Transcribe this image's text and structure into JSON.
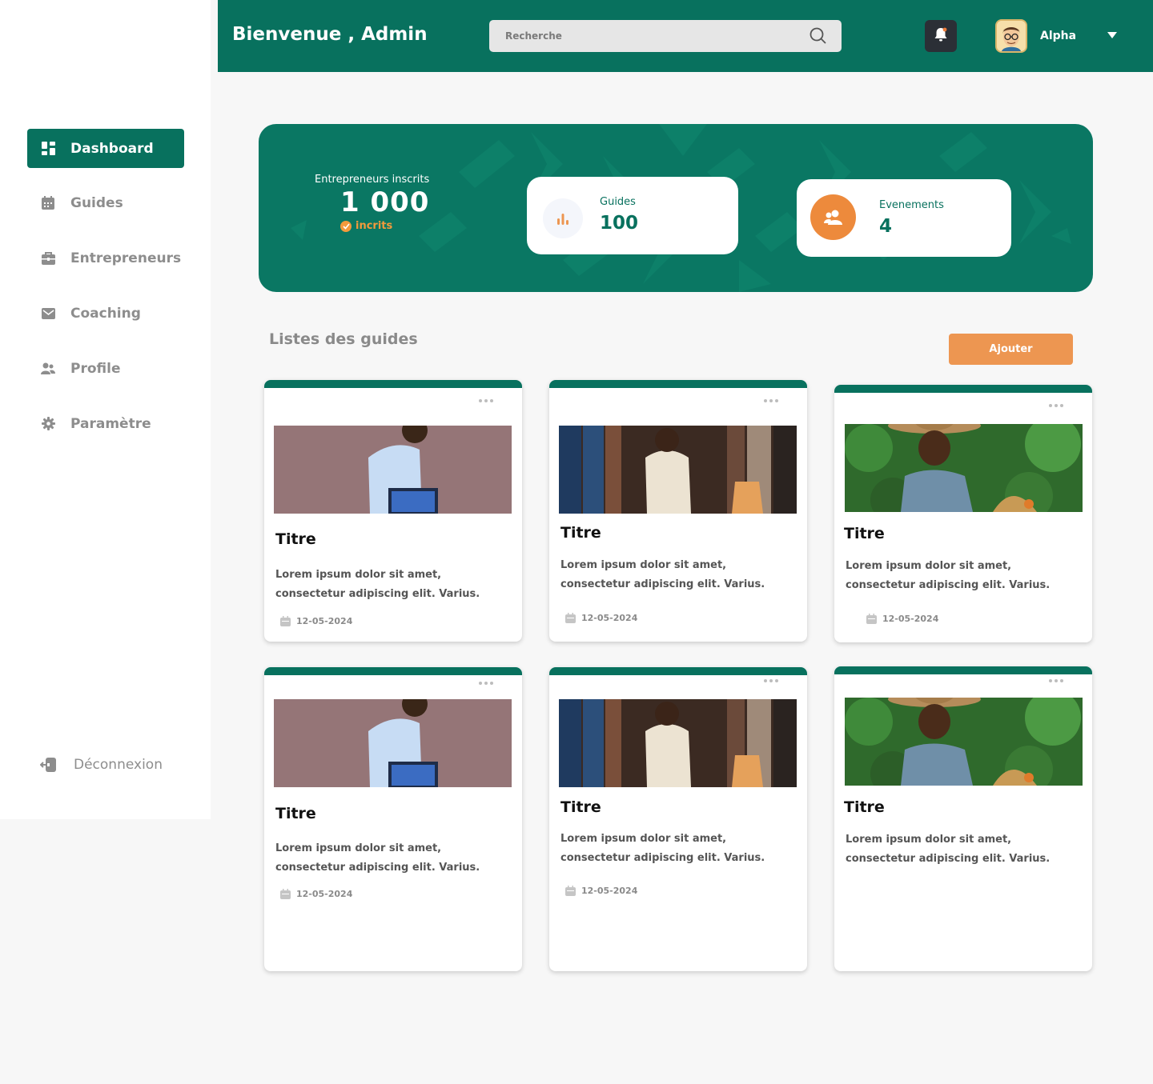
{
  "header": {
    "title": "Bienvenue , Admin",
    "search_placeholder": "Recherche",
    "user_name": "Alpha"
  },
  "sidebar": {
    "items": [
      {
        "label": "Dashboard",
        "icon": "dashboard-icon"
      },
      {
        "label": "Guides",
        "icon": "calendar-icon"
      },
      {
        "label": "Entrepreneurs",
        "icon": "briefcase-icon"
      },
      {
        "label": "Coaching",
        "icon": "mail-icon"
      },
      {
        "label": "Profile",
        "icon": "users-icon"
      },
      {
        "label": "Paramètre",
        "icon": "gear-icon"
      }
    ],
    "logout": "Déconnexion"
  },
  "banner": {
    "main_label": "Entrepreneurs inscrits",
    "main_value": "1 000",
    "main_sub": "incrits",
    "guides_label": "Guides",
    "guides_value": "100",
    "events_label": "Evenements",
    "events_value": "4"
  },
  "section": {
    "title": "Listes des guides",
    "add_label": "Ajouter"
  },
  "cards": [
    {
      "title": "Titre",
      "desc": "Lorem ipsum dolor sit amet, consectetur adipiscing elit. Varius.",
      "date": "12-05-2024"
    },
    {
      "title": "Titre",
      "desc": "Lorem ipsum dolor sit amet, consectetur adipiscing elit. Varius.",
      "date": "12-05-2024"
    },
    {
      "title": "Titre",
      "desc": "Lorem ipsum dolor sit amet, consectetur adipiscing elit. Varius.",
      "date": "12-05-2024"
    },
    {
      "title": "Titre",
      "desc": "Lorem ipsum dolor sit amet, consectetur adipiscing elit. Varius.",
      "date": "12-05-2024"
    },
    {
      "title": "Titre",
      "desc": "Lorem ipsum dolor sit amet, consectetur adipiscing elit. Varius.",
      "date": "12-05-2024"
    },
    {
      "title": "Titre",
      "desc": "Lorem ipsum dolor sit amet, consectetur adipiscing elit. Varius."
    }
  ],
  "colors": {
    "brand_green": "#08715e",
    "accent_orange": "#ed9651"
  }
}
